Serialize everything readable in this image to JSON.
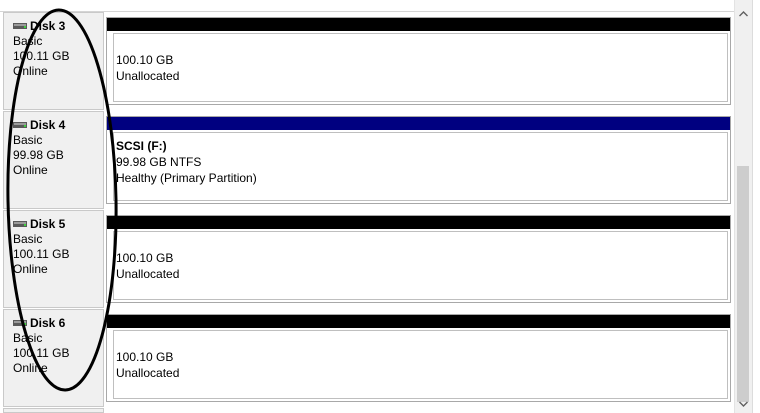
{
  "disks": [
    {
      "name": "Disk 3",
      "type": "Basic",
      "size": "100.11 GB",
      "status": "Online",
      "partition": {
        "label": "",
        "size": "100.10 GB",
        "state": "Unallocated",
        "bar_color": "#000000"
      }
    },
    {
      "name": "Disk 4",
      "type": "Basic",
      "size": "99.98 GB",
      "status": "Online",
      "partition": {
        "label": "SCSI  (F:)",
        "size": "99.98 GB NTFS",
        "state": "Healthy (Primary Partition)",
        "bar_color": "#000080"
      }
    },
    {
      "name": "Disk 5",
      "type": "Basic",
      "size": "100.11 GB",
      "status": "Online",
      "partition": {
        "label": "",
        "size": "100.10 GB",
        "state": "Unallocated",
        "bar_color": "#000000"
      }
    },
    {
      "name": "Disk 6",
      "type": "Basic",
      "size": "100.11 GB",
      "status": "Online",
      "partition": {
        "label": "",
        "size": "100.10 GB",
        "state": "Unallocated",
        "bar_color": "#000000"
      }
    }
  ],
  "scrollbar": {
    "up_icon": "chevron-up-icon",
    "down_icon": "chevron-down-icon"
  },
  "colors": {
    "disk_label_bg": "#f0f0f0",
    "annotation_stroke": "#000000"
  }
}
